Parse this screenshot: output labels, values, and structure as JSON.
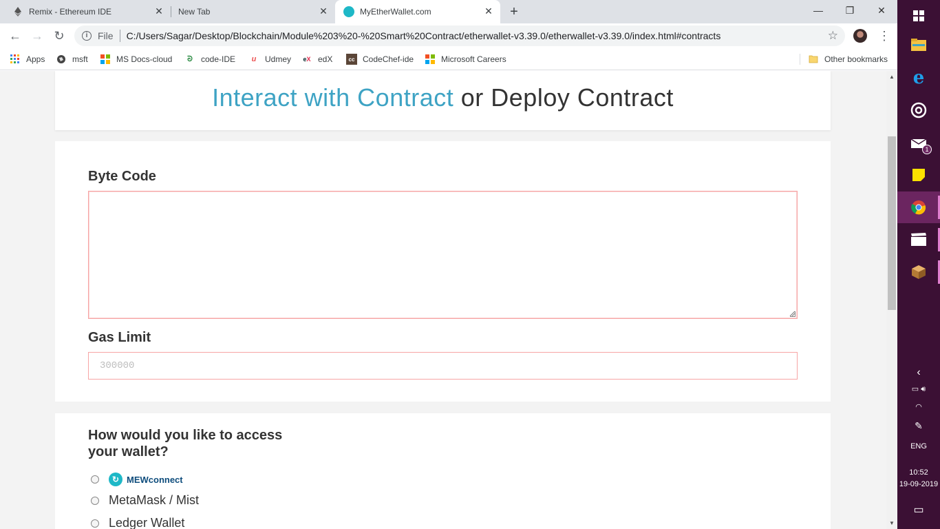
{
  "browser": {
    "tabs": [
      {
        "title": "Remix - Ethereum IDE",
        "active": false
      },
      {
        "title": "New Tab",
        "active": false
      },
      {
        "title": "MyEtherWallet.com",
        "active": true
      }
    ],
    "new_tab_symbol": "+",
    "close_symbol": "✕",
    "window_controls": {
      "minimize": "—",
      "maximize": "❐",
      "close": "✕"
    },
    "toolbar": {
      "back_symbol": "←",
      "forward_symbol": "→",
      "reload_symbol": "↻",
      "site_info_symbol": "i",
      "scheme_label": "File",
      "url": "C:/Users/Sagar/Desktop/Blockchain/Module%203%20-%20Smart%20Contract/etherwallet-v3.39.0/etherwallet-v3.39.0/index.html#contracts",
      "star_symbol": "☆",
      "menu_symbol": "⋮"
    },
    "bookmarks": [
      {
        "label": "Apps",
        "icon": "apps-grid-icon"
      },
      {
        "label": "msft",
        "icon": "globe-icon"
      },
      {
        "label": "MS Docs-cloud",
        "icon": "microsoft-logo-icon"
      },
      {
        "label": "code-IDE",
        "icon": "geeksforgeeks-icon"
      },
      {
        "label": "Udmey",
        "icon": "udemy-icon"
      },
      {
        "label": "edX",
        "icon": "edx-icon"
      },
      {
        "label": "CodeChef-ide",
        "icon": "codechef-icon"
      },
      {
        "label": "Microsoft Careers",
        "icon": "microsoft-logo-icon"
      }
    ],
    "other_bookmarks": "Other bookmarks"
  },
  "page": {
    "title_interact": "Interact with Contract",
    "title_or": "or",
    "title_deploy": "Deploy Contract",
    "bytecode_label": "Byte Code",
    "bytecode_value": "",
    "gas_label": "Gas Limit",
    "gas_placeholder": "300000",
    "access_title": "How would you like to access your wallet?",
    "access_options": [
      {
        "label": "MEWconnect",
        "icon": "mewconnect-logo-icon"
      },
      {
        "label": "MetaMask / Mist"
      },
      {
        "label": "Ledger Wallet"
      }
    ]
  },
  "taskbar": {
    "items": [
      "windows-start-icon",
      "file-explorer-icon",
      "edge-icon",
      "groove-icon",
      "mail-icon",
      "sticky-notes-icon",
      "chrome-icon",
      "movies-icon",
      "package-icon"
    ],
    "mail_badge": "1",
    "language": "ENG",
    "time": "10:52",
    "date": "19-09-2019"
  },
  "colors": {
    "accent_blue": "#3ea3c4",
    "error_border": "#f7a5a5",
    "taskbar_bg": "#3b1034",
    "taskbar_active": "#6b2560"
  }
}
